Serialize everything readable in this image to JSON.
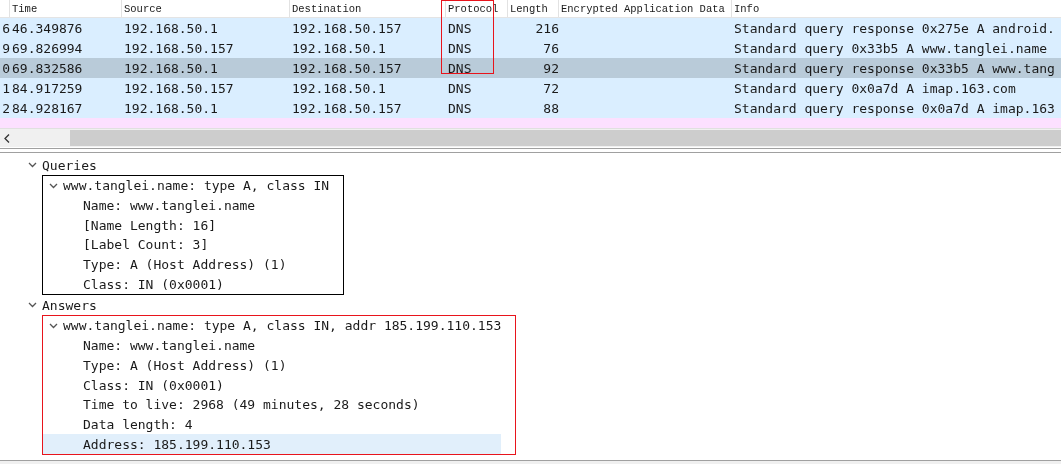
{
  "packet_list": {
    "columns": [
      {
        "label": "Time"
      },
      {
        "label": "Source"
      },
      {
        "label": "Destination"
      },
      {
        "label": "Protocol",
        "color": "#e8141c"
      },
      {
        "label": "Length"
      },
      {
        "label": "Encrypted Application Data"
      },
      {
        "label": "Info"
      }
    ],
    "rows": [
      {
        "cells": [
          "6",
          "46.349876",
          "192.168.50.1",
          "192.168.50.157",
          "DNS",
          "216",
          "",
          "Standard query response 0x275e A android."
        ],
        "color": "#daeeff",
        "selected": false
      },
      {
        "cells": [
          "9",
          "69.826994",
          "192.168.50.157",
          "192.168.50.1",
          "DNS",
          "76",
          "",
          "Standard query 0x33b5 A www.tanglei.name"
        ],
        "color": "#daeeff",
        "selected": false
      },
      {
        "cells": [
          "0",
          "69.832586",
          "192.168.50.1",
          "192.168.50.157",
          "DNS",
          "92",
          "",
          "Standard query response 0x33b5 A www.tang"
        ],
        "selected": true
      },
      {
        "cells": [
          "1",
          "84.917259",
          "192.168.50.157",
          "192.168.50.1",
          "DNS",
          "72",
          "",
          "Standard query 0x0a7d A imap.163.com"
        ],
        "color": "#daeeff",
        "selected": false
      },
      {
        "cells": [
          "2",
          "84.928167",
          "192.168.50.1",
          "192.168.50.157",
          "DNS",
          "88",
          "",
          "Standard query response 0x0a7d A imap.163"
        ],
        "color": "#daeeff",
        "selected": false
      },
      {
        "color": "#fce0ff",
        "selected": false
      }
    ]
  },
  "details": [
    {
      "label": "Queries",
      "kind": "node",
      "expanded": true,
      "selected": false,
      "children": [
        {
          "label": "www.tanglei.name: type A, class IN",
          "kind": "node",
          "expanded": true,
          "selected": false,
          "color": "#000000",
          "children": [
            {
              "label": "Name: www.tanglei.name",
              "kind": "leaf",
              "selected": false
            },
            {
              "label": "[Name Length: 16]",
              "kind": "leaf",
              "selected": false
            },
            {
              "label": "[Label Count: 3]",
              "kind": "leaf",
              "selected": false
            },
            {
              "label": "Type: A (Host Address) (1)",
              "kind": "leaf",
              "selected": false
            },
            {
              "label": "Class: IN (0x0001)",
              "kind": "leaf",
              "selected": false
            }
          ]
        }
      ]
    },
    {
      "label": "Answers",
      "kind": "node",
      "expanded": true,
      "selected": false,
      "children": [
        {
          "label": "www.tanglei.name: type A, class IN, addr 185.199.110.153",
          "kind": "node",
          "expanded": true,
          "selected": false,
          "color": "#e8141c",
          "children": [
            {
              "label": "Name: www.tanglei.name",
              "kind": "leaf",
              "selected": false
            },
            {
              "label": "Type: A (Host Address) (1)",
              "kind": "leaf",
              "selected": false
            },
            {
              "label": "Class: IN (0x0001)",
              "kind": "leaf",
              "selected": false
            },
            {
              "label": "Time to live: 2968 (49 minutes, 28 seconds)",
              "kind": "leaf",
              "selected": false
            },
            {
              "label": "Data length: 4",
              "kind": "leaf",
              "selected": false
            },
            {
              "label": "Address: 185.199.110.153",
              "kind": "leaf",
              "selected": true
            }
          ]
        }
      ]
    }
  ]
}
